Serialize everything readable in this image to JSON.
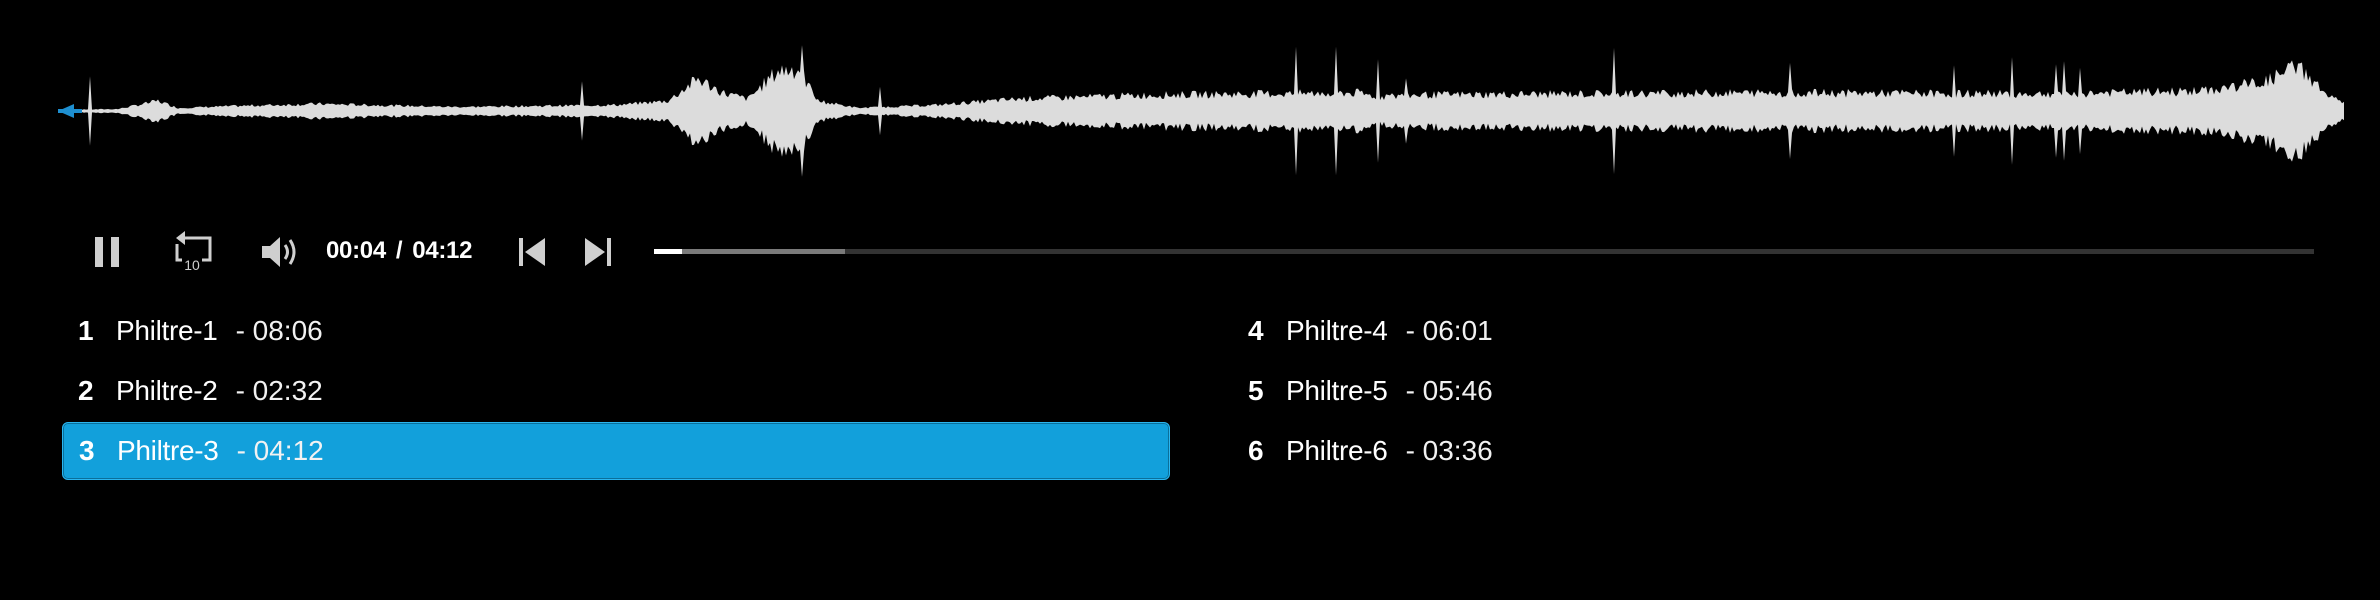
{
  "player": {
    "current_time": "00:04",
    "separator": "/",
    "total_time": "04:12",
    "progress_fraction": 0.0026,
    "buffer_fraction": 0.115,
    "colors": {
      "accent": "#12a0db",
      "waveform": "#dcdcdc",
      "playhead": "#1e8fd0",
      "background": "#000000"
    },
    "icons": {
      "pause": "pause-icon",
      "rewind": "rewind-10-icon",
      "volume": "volume-icon",
      "prev": "skip-previous-icon",
      "next": "skip-next-icon"
    },
    "rewind_seconds": "10"
  },
  "playlist": [
    {
      "num": "1",
      "title": "Philtre-1",
      "duration": "- 08:06",
      "active": false
    },
    {
      "num": "2",
      "title": "Philtre-2",
      "duration": "- 02:32",
      "active": false
    },
    {
      "num": "3",
      "title": "Philtre-3",
      "duration": "- 04:12",
      "active": true
    },
    {
      "num": "4",
      "title": "Philtre-4",
      "duration": "- 06:01",
      "active": false
    },
    {
      "num": "5",
      "title": "Philtre-5",
      "duration": "- 05:46",
      "active": false
    },
    {
      "num": "6",
      "title": "Philtre-6",
      "duration": "- 03:36",
      "active": false
    }
  ]
}
